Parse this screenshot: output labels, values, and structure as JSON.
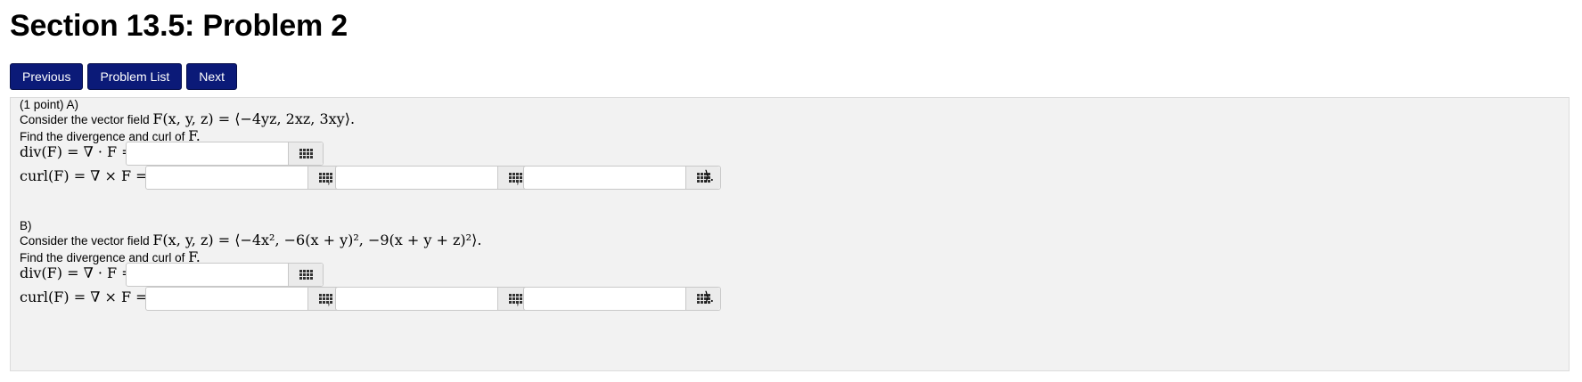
{
  "page": {
    "title": "Section 13.5: Problem 2"
  },
  "nav": {
    "previous": "Previous",
    "problem_list": "Problem List",
    "next": "Next"
  },
  "partA": {
    "header": "(1 point) A)",
    "consider_text": "Consider the vector field ",
    "field_math": "F(x, y, z) = ⟨−4yz, 2xz, 3xy⟩.",
    "find_text": "Find the divergence and curl of ",
    "find_math": "F.",
    "div_label": "div(F) = ∇ · F =",
    "curl_label": "curl(F) = ∇ × F = ⟨",
    "div_value": "",
    "curl1_value": "",
    "curl2_value": "",
    "curl3_value": ""
  },
  "partB": {
    "header": "B)",
    "consider_text": "Consider the vector field ",
    "field_math": "F(x, y, z) = ⟨−4x², −6(x + y)², −9(x + y + z)²⟩.",
    "find_text": "Find the divergence and curl of ",
    "find_math": "F.",
    "div_label": "div(F) = ∇ · F =",
    "curl_label": "curl(F) = ∇ × F = ⟨",
    "div_value": "",
    "curl1_value": "",
    "curl2_value": "",
    "curl3_value": ""
  },
  "punct": {
    "period": ".",
    "comma": ",",
    "close": "⟩."
  },
  "icons": {
    "math_editor": "grid-keypad-icon"
  }
}
